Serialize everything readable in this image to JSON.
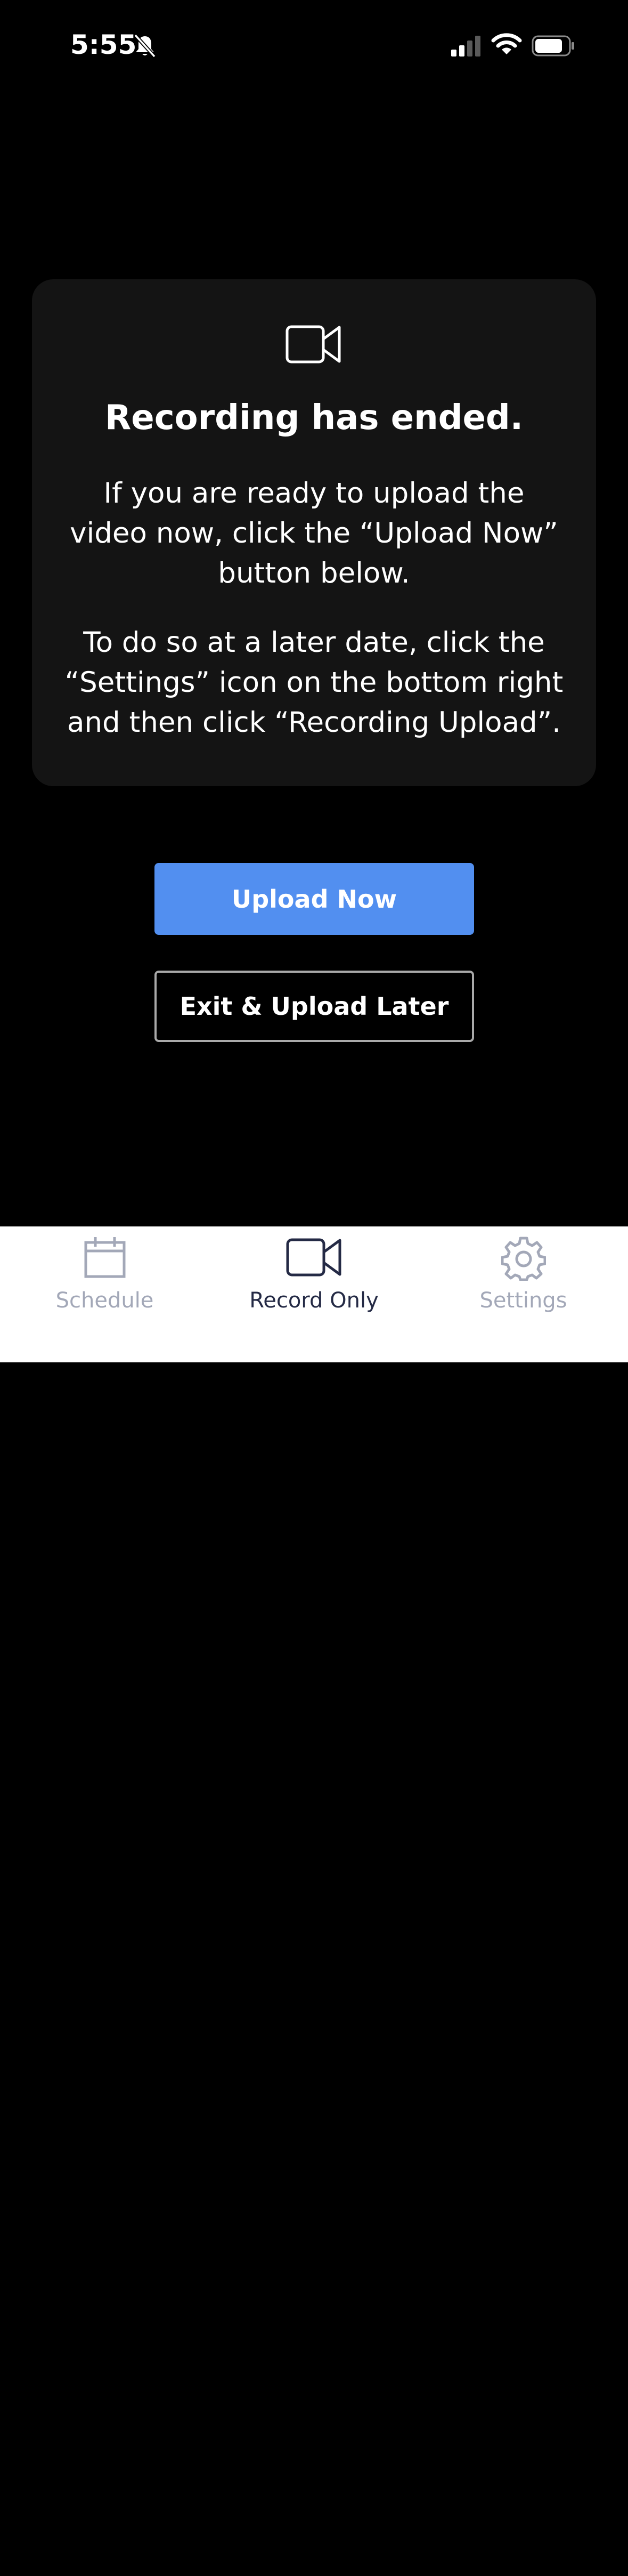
{
  "status_bar": {
    "time": "5:55"
  },
  "card": {
    "title": "Recording has ended.",
    "paragraph_1": "If you are ready to upload the\nvideo now, click the “Upload Now”\nbutton below.",
    "paragraph_2": "To do so at a later date, click the\n“Settings” icon on the bottom right\nand then click “Recording Upload”."
  },
  "buttons": {
    "upload_now": "Upload Now",
    "exit_upload_later": "Exit & Upload Later"
  },
  "tab_bar": {
    "tabs": [
      {
        "label": "Schedule",
        "icon": "calendar-icon",
        "active": false
      },
      {
        "label": "Record Only",
        "icon": "video-camera-icon",
        "active": true
      },
      {
        "label": "Settings",
        "icon": "gear-icon",
        "active": false
      }
    ]
  },
  "colors": {
    "background": "#000000",
    "card": "#141414",
    "primary_button": "#528ff0",
    "tab_active": "#242a45",
    "tab_inactive": "#a3a8b8"
  }
}
